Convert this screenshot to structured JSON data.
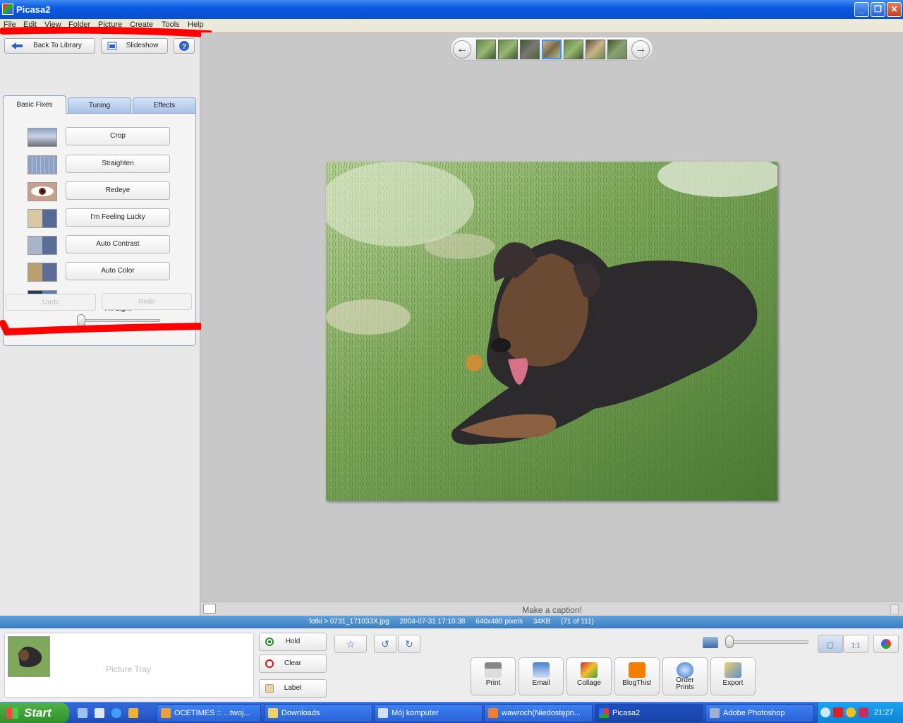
{
  "window": {
    "title": "Picasa2"
  },
  "menu": [
    "File",
    "Edit",
    "View",
    "Folder",
    "Picture",
    "Create",
    "Tools",
    "Help"
  ],
  "toolbar": {
    "back_label": "Back To Library",
    "slideshow_label": "Slideshow",
    "help_label": "?"
  },
  "tabs": [
    {
      "label": "Basic Fixes"
    },
    {
      "label": "Tuning"
    },
    {
      "label": "Effects"
    }
  ],
  "fixes": [
    {
      "label": "Crop"
    },
    {
      "label": "Straighten"
    },
    {
      "label": "Redeye"
    },
    {
      "label": "I'm Feeling Lucky"
    },
    {
      "label": "Auto Contrast"
    },
    {
      "label": "Auto Color"
    }
  ],
  "fill_light": {
    "label": "Fill Light",
    "value": 0
  },
  "undo_label": "Undo",
  "redo_label": "Redo",
  "caption": {
    "placeholder": "Make a caption!"
  },
  "info": {
    "path": "fotki > 0731_171033X.jpg",
    "date": "2004-07-31 17:10:38",
    "dimensions": "640x480 pixels",
    "size": "34KB",
    "position": "(71 of 111)"
  },
  "tray": {
    "label": "Picture Tray",
    "hold_label": "Hold",
    "clear_label": "Clear",
    "label_label": "Label"
  },
  "actions": [
    {
      "label": "Print"
    },
    {
      "label": "Email"
    },
    {
      "label": "Collage"
    },
    {
      "label": "BlogThis!"
    },
    {
      "label": "Order Prints"
    },
    {
      "label": "Export"
    }
  ],
  "taskbar": {
    "start_label": "Start",
    "tasks": [
      {
        "label": "OCETIMES :: ...twoj..."
      },
      {
        "label": "Downloads"
      },
      {
        "label": "Mój komputer"
      },
      {
        "label": "wawroch(Niedostępn..."
      },
      {
        "label": "Picasa2"
      },
      {
        "label": "Adobe Photoshop"
      }
    ],
    "clock": "21:27"
  },
  "colors": {
    "titlebar": "#0a5ae0",
    "tab_active": "#f4f4f4",
    "annotation": "#ff0000",
    "taskbar": "#2b5fd0",
    "start": "#3a9c35"
  }
}
